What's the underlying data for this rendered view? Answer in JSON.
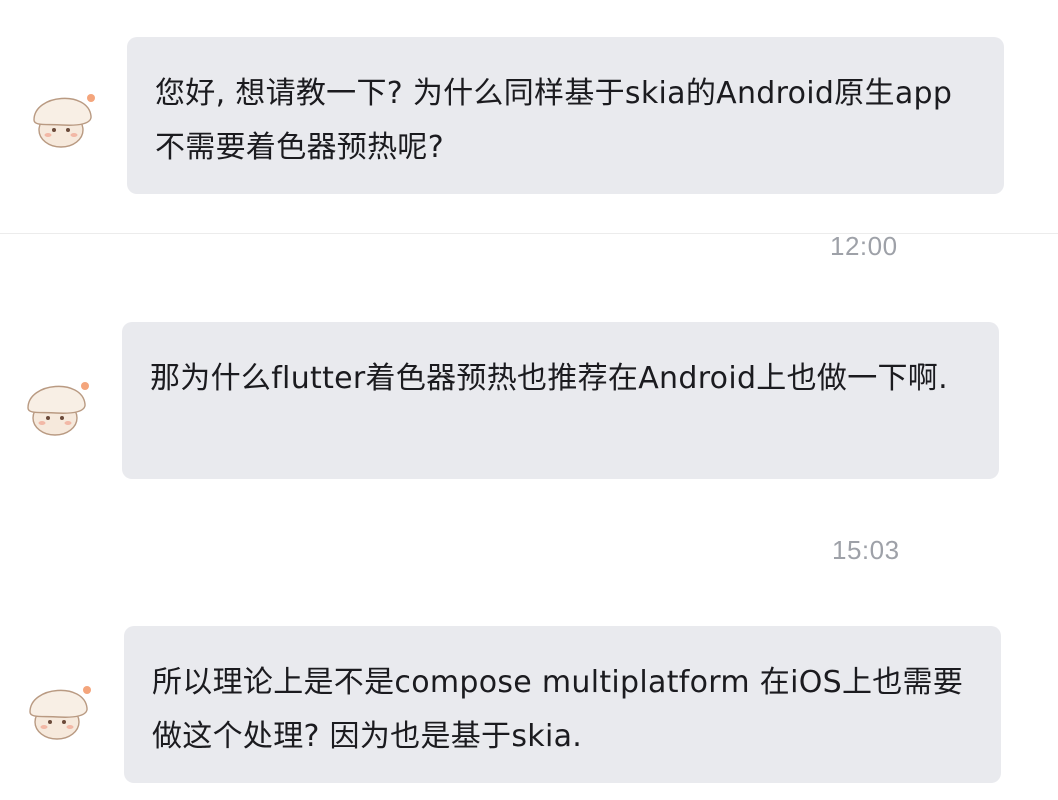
{
  "messages": [
    {
      "text": "您好, 想请教一下? 为什么同样基于skia的Android原生app 不需要着色器预热呢?",
      "avatar_icon": "mushroom-avatar-icon"
    },
    {
      "time": "12:00",
      "text": "那为什么flutter着色器预热也推荐在Android上也做一下啊.",
      "avatar_icon": "mushroom-avatar-icon"
    },
    {
      "time": "15:03",
      "text": "所以理论上是不是compose multiplatform 在iOS上也需要做这个处理? 因为也是基于skia.",
      "avatar_icon": "mushroom-avatar-icon"
    }
  ],
  "colors": {
    "bubble_bg": "#e9eaee",
    "text": "#1b1b1f",
    "timestamp": "#9ea1a8"
  }
}
